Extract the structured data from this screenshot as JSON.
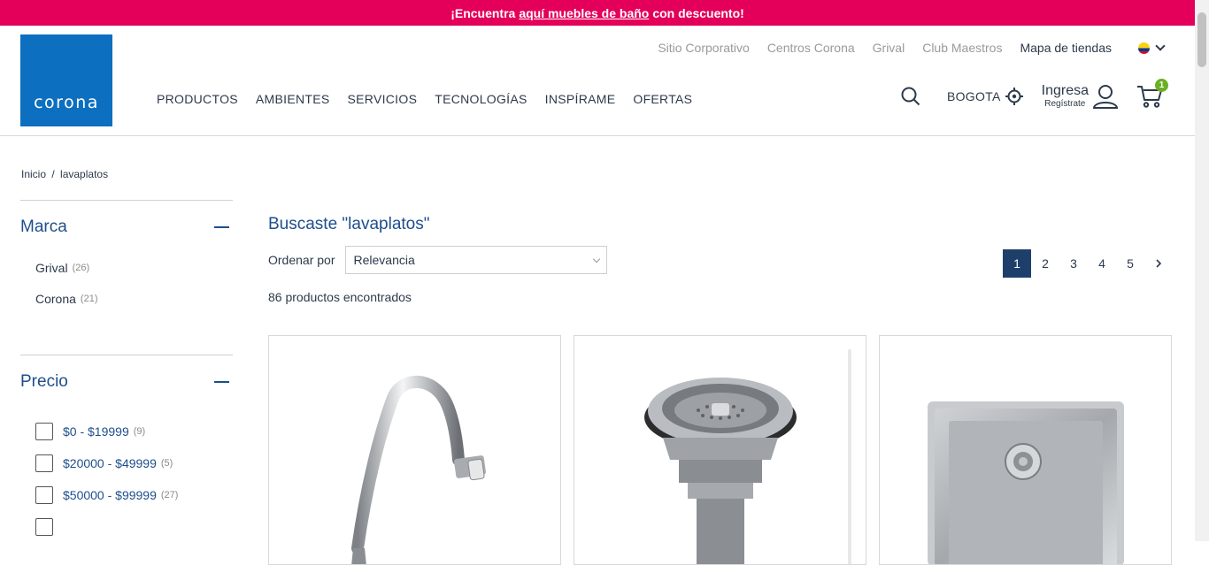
{
  "promo": {
    "pre": "¡Encuentra",
    "link": "aquí muebles de baño",
    "post": "con descuento!"
  },
  "logo": {
    "text": "corona"
  },
  "toplinks": [
    "Sitio Corporativo",
    "Centros Corona",
    "Grival",
    "Club Maestros",
    "Mapa de tiendas"
  ],
  "nav": [
    "PRODUCTOS",
    "AMBIENTES",
    "SERVICIOS",
    "TECNOLOGÍAS",
    "INSPÍRAME",
    "OFERTAS"
  ],
  "header_right": {
    "city": "BOGOTA",
    "login": "Ingresa",
    "register": "Regístrate",
    "cart_count": "1"
  },
  "breadcrumb": {
    "home": "Inicio",
    "sep": "/",
    "current": "lavaplatos"
  },
  "filters": {
    "brand": {
      "title": "Marca",
      "items": [
        {
          "label": "Grival",
          "count": "(26)"
        },
        {
          "label": "Corona",
          "count": "(21)"
        }
      ]
    },
    "price": {
      "title": "Precio",
      "items": [
        {
          "label": "$0 - $19999",
          "count": "(9)"
        },
        {
          "label": "$20000 - $49999",
          "count": "(5)"
        },
        {
          "label": "$50000 - $99999",
          "count": "(27)"
        }
      ]
    }
  },
  "results": {
    "title": "Buscaste \"lavaplatos\"",
    "sort_label": "Ordenar por",
    "sort_value": "Relevancia",
    "count_text": "86 productos encontrados",
    "pages": [
      "1",
      "2",
      "3",
      "4",
      "5"
    ],
    "current_page": "1"
  },
  "colors": {
    "promo": "#e4005a",
    "brand": "#0c6fbf",
    "accent": "#1f4e8c",
    "badge": "#6bb024"
  }
}
